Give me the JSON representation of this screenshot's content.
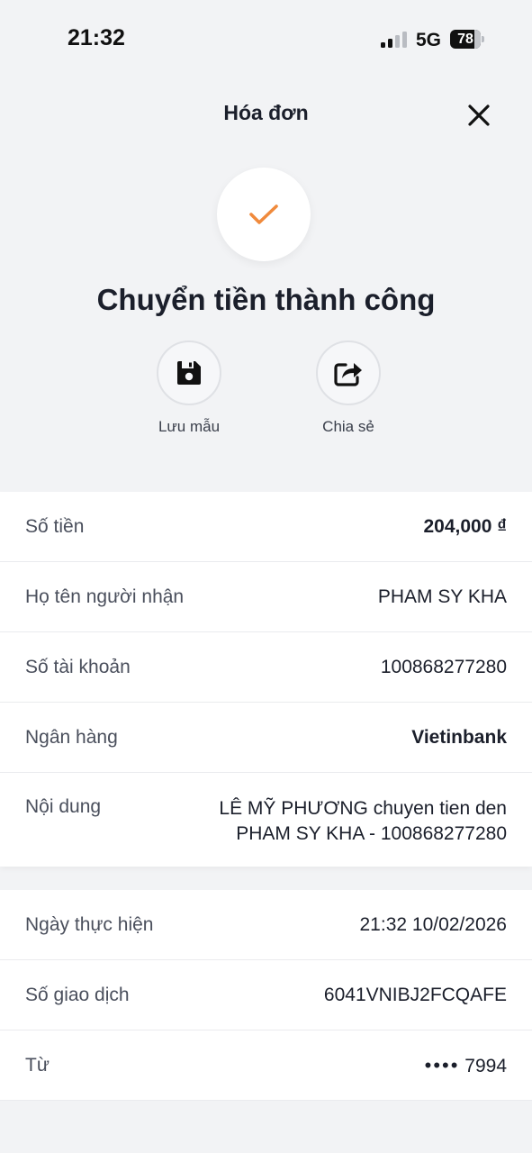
{
  "status_bar": {
    "time": "21:32",
    "network": "5G",
    "battery": "78"
  },
  "header": {
    "title": "Hóa đơn"
  },
  "result": {
    "title": "Chuyển tiền thành công",
    "icon": "checkmark-icon",
    "accent_color": "#f08a3c"
  },
  "actions": [
    {
      "label": "Lưu mẫu",
      "icon": "save-icon"
    },
    {
      "label": "Chia sẻ",
      "icon": "share-icon"
    }
  ],
  "details": [
    {
      "label": "Số tiền",
      "value": "204,000 ₫"
    },
    {
      "label": "Họ tên người nhận",
      "value": "PHAM SY KHA"
    },
    {
      "label": "Số tài khoản",
      "value": "100868277280"
    },
    {
      "label": "Ngân hàng",
      "value": "Vietinbank"
    },
    {
      "label": "Nội dung",
      "value_line1": "LÊ MỸ PHƯƠNG chuyen tien den",
      "value_line2": "PHAM SY KHA - 100868277280"
    }
  ],
  "transaction": [
    {
      "label": "Ngày thực hiện",
      "value": "21:32 10/02/2026"
    },
    {
      "label": "Số giao dịch",
      "value": "6041VNIBJ2FCQAFE"
    },
    {
      "label": "Từ",
      "dots": "••••",
      "value": "7994"
    }
  ]
}
